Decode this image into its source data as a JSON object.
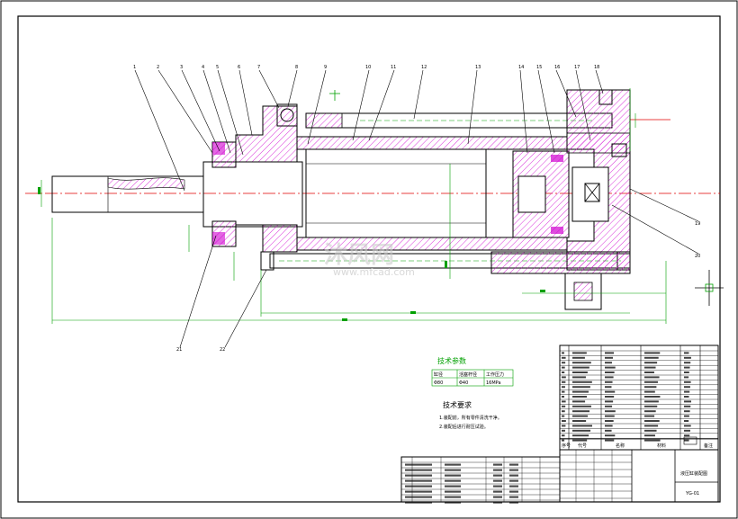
{
  "part_numbers": [
    "1",
    "2",
    "3",
    "4",
    "5",
    "6",
    "7",
    "8",
    "9",
    "10",
    "11",
    "12",
    "13",
    "14",
    "15",
    "16",
    "17",
    "18",
    "19",
    "20",
    "21",
    "22"
  ],
  "tech_params": {
    "title": "技术参数",
    "headers": [
      "缸径",
      "活塞杆径",
      "工作压力"
    ],
    "row": [
      "Φ80",
      "Φ40",
      "16MPa"
    ]
  },
  "tech_requirements": {
    "title": "技术要求",
    "items": [
      "1.装配前，所有零件清洗干净。",
      "2.装配后进行耐压试验。"
    ]
  },
  "title_block": {
    "drawing_name": "液压缸装配图",
    "drawing_no": "YG-01",
    "col_no": "序号",
    "col_code": "代号",
    "col_name": "名称",
    "col_material": "材料",
    "col_remark": "备注"
  },
  "watermark": {
    "brand": "沐风网",
    "url": "www.mfcad.com"
  },
  "colors": {
    "line": "#000000",
    "hatch": "#d000d0",
    "dim": "#00a000",
    "center": "#e00000",
    "background": "#ffffff"
  }
}
